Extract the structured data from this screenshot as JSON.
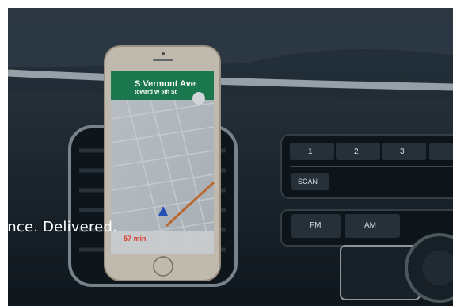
{
  "hero": {
    "tagline": "ence. Delivered."
  },
  "phone": {
    "street": "S Vermont Ave",
    "toward": "toward W 5th St",
    "eta": "57 min"
  },
  "radio": {
    "preset_1": "1",
    "preset_2": "2",
    "preset_3": "3",
    "scan": "SCAN",
    "fm": "FM",
    "am": "AM"
  },
  "colors": {
    "nav_green": "#1e8b57",
    "dashboard": "#1b2329",
    "overlay": "#0d1a26"
  }
}
